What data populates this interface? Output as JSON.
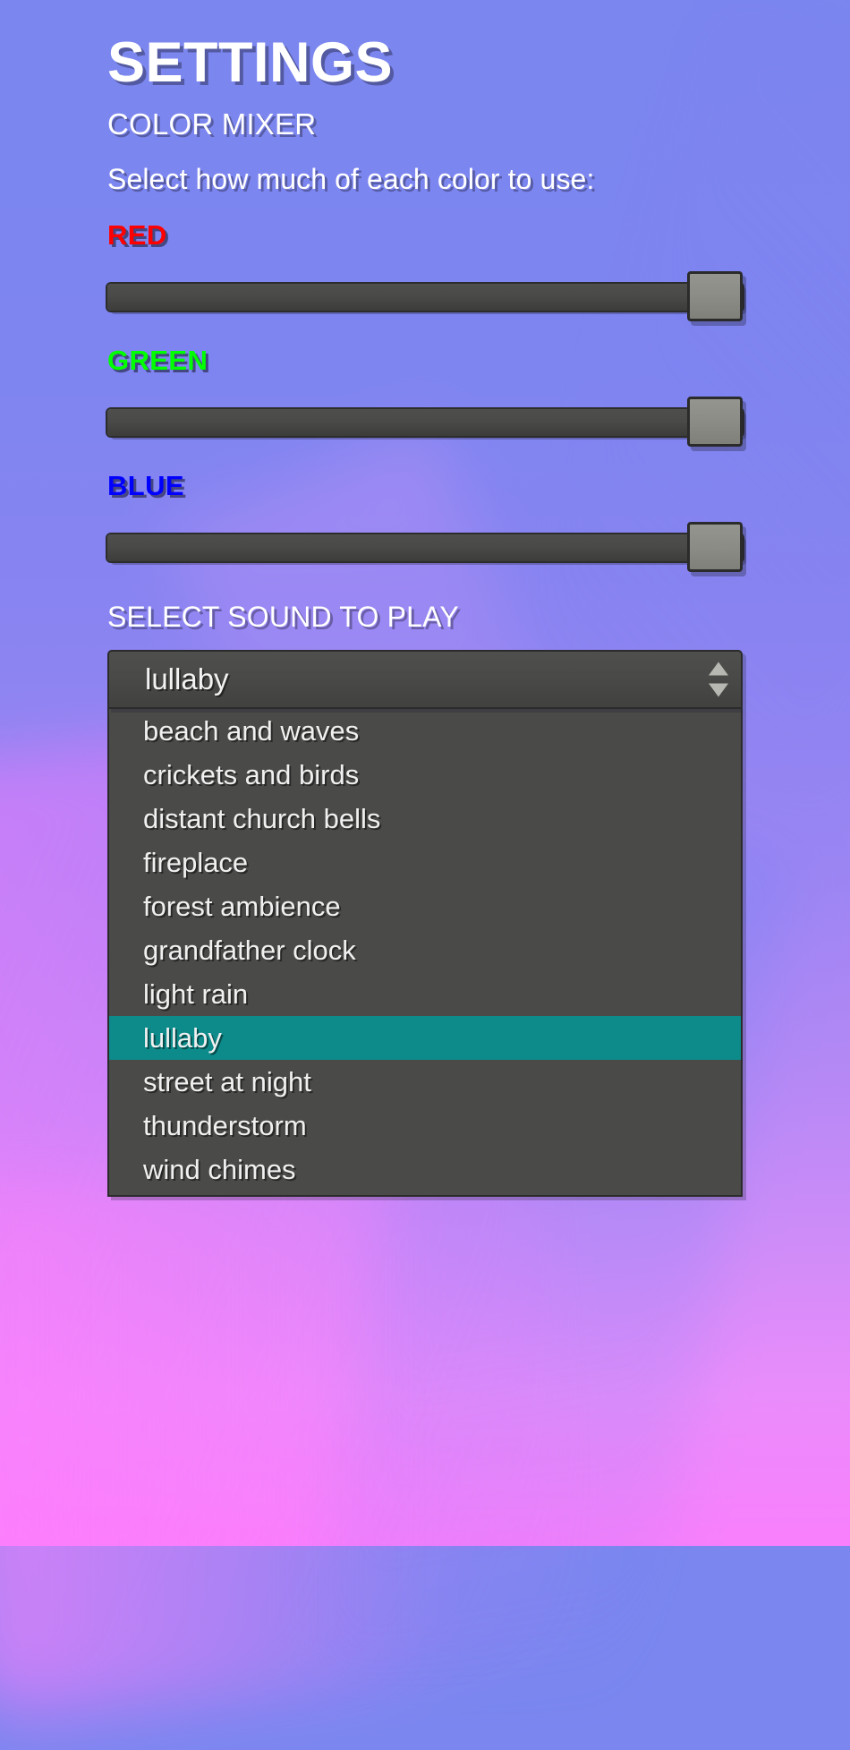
{
  "header": {
    "title": "SETTINGS",
    "subtitle": "COLOR MIXER",
    "instruction": "Select how much of each color to use:"
  },
  "color_mixer": {
    "channels": [
      {
        "label": "RED",
        "color": "#ff0000",
        "value": 100,
        "min": 0,
        "max": 100
      },
      {
        "label": "GREEN",
        "color": "#00ff00",
        "value": 100,
        "min": 0,
        "max": 100
      },
      {
        "label": "BLUE",
        "color": "#0000ff",
        "value": 100,
        "min": 0,
        "max": 100
      }
    ]
  },
  "sound": {
    "section_label": "SELECT SOUND TO PLAY",
    "selected": "lullaby",
    "spinner_up_icon": "caret-up-icon",
    "spinner_down_icon": "caret-down-icon",
    "highlight_color": "#0d8b8b",
    "options": [
      "beach and waves",
      "crickets and birds",
      "distant church bells",
      "fireplace",
      "forest ambience",
      "grandfather clock",
      "light rain",
      "lullaby",
      "street at night",
      "thunderstorm",
      "wind chimes"
    ]
  }
}
